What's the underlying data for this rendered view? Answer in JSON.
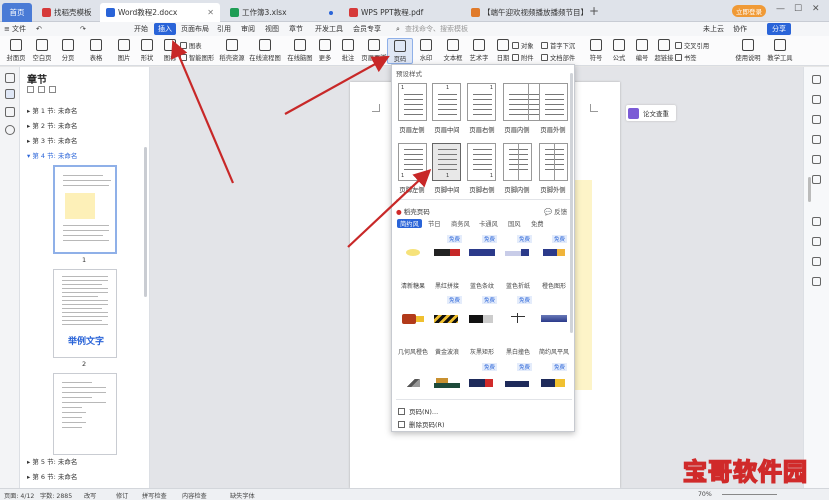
{
  "tabs": {
    "home": "首页",
    "t1": "找稻壳模板",
    "t2": "Word教程2.docx",
    "t3": "工作簿3.xlsx",
    "t4": "WPS PPT教程.pdf",
    "t5": "【端午迎欢视频播放播频节目】",
    "new_tab": "+"
  },
  "top_right": {
    "login": "立即登录",
    "cloud": "未上云",
    "collab": "协作",
    "share": "分享"
  },
  "menu": {
    "file": "文件",
    "items": [
      "开始",
      "插入",
      "页面布局",
      "引用",
      "审阅",
      "视图",
      "章节",
      "开发工具",
      "会员专享"
    ],
    "search": "查找命令、搜索模板"
  },
  "ribbon": {
    "buttons": [
      "封面页",
      "空白页",
      "分页",
      "表格",
      "图片",
      "形状",
      "图标",
      "稻壳资源",
      "在线流程图",
      "在线脑图",
      "更多",
      "批注",
      "页眉页脚",
      "页码",
      "水印",
      "文本框",
      "艺术字",
      "日期",
      "附件",
      "文档部件",
      "符号",
      "公式",
      "编号",
      "超链接",
      "书签",
      "交叉引用",
      "使用说明",
      "教学工具"
    ],
    "small": [
      "图表",
      "智能图形",
      "对象",
      "首字下沉",
      "文档部件"
    ]
  },
  "panel": {
    "title": "章节",
    "sections": [
      "第 1 节: 未命名",
      "第 2 节: 未命名",
      "第 3 节: 未命名",
      "第 4 节: 未命名",
      "第 5 节: 未命名",
      "第 6 节: 未命名"
    ],
    "page_nums": [
      "1",
      "2"
    ],
    "example_text": "举例文字"
  },
  "paper_chip": "论文查重",
  "dropdown": {
    "preset_title": "预设样式",
    "top_labels": [
      "页眉左侧",
      "页眉中间",
      "页眉右侧",
      "页眉内侧",
      "页眉外侧"
    ],
    "bottom_labels": [
      "页脚左侧",
      "页脚中间",
      "页脚右侧",
      "页脚内侧",
      "页脚外侧"
    ],
    "page_number": "1",
    "lib_title": "稻壳页码",
    "feedback": "反馈",
    "categories": [
      "简约风",
      "节日",
      "商务风",
      "卡通风",
      "国风",
      "免费"
    ],
    "free_badge": "免费",
    "style_row1_labels": [
      "清新糖果",
      "黑红拼接",
      "蓝色条纹",
      "蓝色折纸",
      "橙色图形"
    ],
    "style_row2_labels": [
      "几何风橙色",
      "黄金波浪",
      "灰黑矩形",
      "黑白撞色",
      "简约风平风"
    ],
    "item_page_number": "页码(N)...",
    "item_delete": "删除页码(R)"
  },
  "status": {
    "page": "页面: 4/12",
    "words": "字数: 2885",
    "revise": "改写",
    "check": "修订",
    "spell": "拼写检查",
    "content": "内容检查",
    "font": "缺失字体",
    "zoom": "70%"
  },
  "watermark": "宝哥软件园",
  "colors": {
    "accent": "#2a64d8",
    "tab_bg": "#dfe3ea",
    "arrow": "#c82828",
    "watermark": "#d02a2a"
  }
}
